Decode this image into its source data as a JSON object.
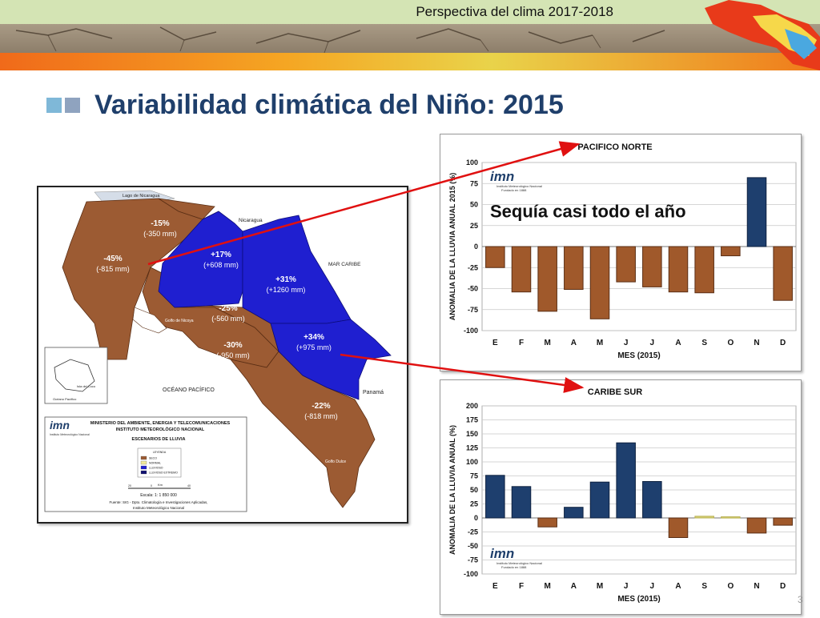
{
  "header": {
    "title": "Perspectiva del clima 2017-2018"
  },
  "page": {
    "title": "Variabilidad climática del Niño: 2015",
    "number": "3"
  },
  "colors": {
    "title": "#1f3f6b",
    "bullet_light": "#7fb8d8",
    "bullet_dark": "#8fa3bf",
    "drought": "#a0592b",
    "wet": "#1e3f6e",
    "map_dry": "#9c5b33",
    "map_wet": "#1f1fd0"
  },
  "map": {
    "labels": {
      "nicaragua_lake": "Lago de Nicaragua",
      "nicaragua": "Nicaragua",
      "caribbean": "MAR CARIBE",
      "pacific": "OCÉANO PACÍFICO",
      "panama": "Panamá",
      "golfo_nicoya": "Golfo de Nicoya",
      "golfo_dulce": "Golfo Dulce",
      "isla_coco": "Isla del Coco",
      "oceano_inset": "Océano Pacífico"
    },
    "regions": [
      {
        "pct": "-15%",
        "mm": "(-350 mm)"
      },
      {
        "pct": "-45%",
        "mm": "(-815 mm)"
      },
      {
        "pct": "+17%",
        "mm": "(+608 mm)"
      },
      {
        "pct": "+31%",
        "mm": "(+1260 mm)"
      },
      {
        "pct": "-25%",
        "mm": "(-560 mm)"
      },
      {
        "pct": "-30%",
        "mm": "(-950 mm)"
      },
      {
        "pct": "+34%",
        "mm": "(+975 mm)"
      },
      {
        "pct": "-22%",
        "mm": "(-818 mm)"
      }
    ],
    "logo": "imn",
    "logo_sub": "Instituto Meteorológico Nacional",
    "ministry": "MINISTERIO DEL AMBIENTE, ENERGIA Y TELECOMUNICACIONES",
    "institute": "INSTITUTO METEOROLÓGICO NACIONAL",
    "scenario": "ESCENARIOS DE LLUVIA",
    "legend_title": "LEYENDA",
    "legend": [
      {
        "label": "SECO",
        "color": "#9c5b33"
      },
      {
        "label": "NORMAL",
        "color": "#f2ea9a"
      },
      {
        "label": "LLUVIOSO",
        "color": "#1f1fd0"
      },
      {
        "label": "LLUVIOSO EXTREMO",
        "color": "#101070"
      }
    ],
    "scale_unit": "Km",
    "scale_ticks": [
      "20",
      "0",
      "40"
    ],
    "scale_text": "Escala: 1: 1 850 000",
    "source_line1": "Fuente: SIG - Dpto. Climatología e Investigaciones Aplicadas,",
    "source_line2": "Instituto Meteorológico Nacional"
  },
  "chart_data": [
    {
      "type": "bar",
      "title": "PACIFICO NORTE",
      "annotation": "Sequía casi todo el año",
      "logo": "imn",
      "logo_sub1": "Instituto Meteorológico Nacional",
      "logo_sub2": "Fundado en 1888",
      "categories": [
        "E",
        "F",
        "M",
        "A",
        "M",
        "J",
        "J",
        "A",
        "S",
        "O",
        "N",
        "D"
      ],
      "values": [
        -25,
        -54,
        -77,
        -51,
        -86,
        -42,
        -48,
        -54,
        -55,
        -11,
        82,
        -64
      ],
      "xlabel": "MES (2015)",
      "ylabel": "ANOMALIA DE LA LLUVIA ANUAL 2015 (%)",
      "ylim": [
        -100,
        100
      ],
      "yticks": [
        -100,
        -75,
        -50,
        -25,
        0,
        25,
        50,
        75,
        100
      ],
      "grid": true,
      "legend": "none"
    },
    {
      "type": "bar",
      "title": "CARIBE SUR",
      "logo": "imn",
      "logo_sub1": "Instituto Meteorológico Nacional",
      "logo_sub2": "Fundado en 1888",
      "categories": [
        "E",
        "F",
        "M",
        "A",
        "M",
        "J",
        "J",
        "A",
        "S",
        "O",
        "N",
        "D"
      ],
      "values": [
        76,
        56,
        -16,
        19,
        64,
        134,
        65,
        -35,
        3,
        2,
        -27,
        -13
      ],
      "xlabel": "MES (2015)",
      "ylabel": "ANOMALIA DE LA LLUVIA ANUAL (%)",
      "ylim": [
        -100,
        200
      ],
      "yticks": [
        -100,
        -75,
        -50,
        -25,
        0,
        25,
        50,
        75,
        100,
        125,
        150,
        175,
        200
      ],
      "grid": true,
      "legend": "none"
    }
  ]
}
